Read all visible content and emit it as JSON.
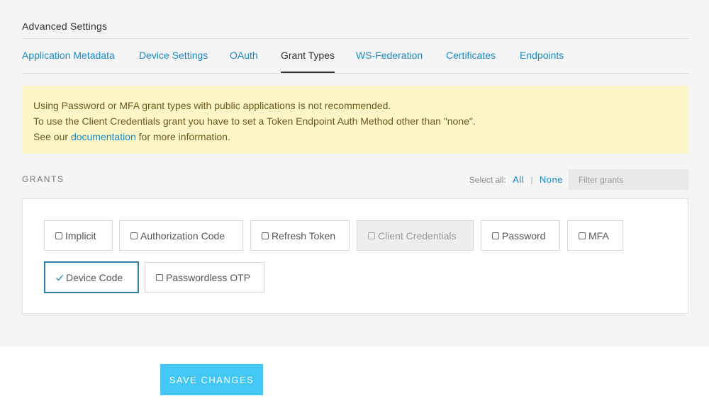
{
  "section_title": "Advanced Settings",
  "tabs": [
    {
      "label": "Application Metadata"
    },
    {
      "label": "Device Settings"
    },
    {
      "label": "OAuth"
    },
    {
      "label": "Grant Types",
      "active": true
    },
    {
      "label": "WS-Federation"
    },
    {
      "label": "Certificates"
    },
    {
      "label": "Endpoints"
    }
  ],
  "notice": {
    "line1": "Using Password or MFA grant types with public applications is not recommended.",
    "line2": "To use the Client Credentials grant you have to set a Token Endpoint Auth Method other than \"none\".",
    "line3_prefix": "See our ",
    "line3_link": "documentation",
    "line3_suffix": " for more information."
  },
  "grants": {
    "label": "GRANTS",
    "select_all_label": "Select all:",
    "select_all_option": "All",
    "select_none_option": "None",
    "filter_placeholder": "Filter grants",
    "items": [
      {
        "label": "Implicit",
        "checked": false,
        "disabled": false
      },
      {
        "label": "Authorization Code",
        "checked": false,
        "disabled": false
      },
      {
        "label": "Refresh Token",
        "checked": false,
        "disabled": false
      },
      {
        "label": "Client Credentials",
        "checked": false,
        "disabled": true
      },
      {
        "label": "Password",
        "checked": false,
        "disabled": false
      },
      {
        "label": "MFA",
        "checked": false,
        "disabled": false
      },
      {
        "label": "Device Code",
        "checked": true,
        "disabled": false
      },
      {
        "label": "Passwordless OTP",
        "checked": false,
        "disabled": false
      }
    ]
  },
  "save_button_label": "SAVE CHANGES",
  "colors": {
    "accent": "#1a8ac6",
    "notice_bg": "#fcf5c7",
    "save_bg": "#44c7f4",
    "selected_border": "#2a83ad"
  }
}
